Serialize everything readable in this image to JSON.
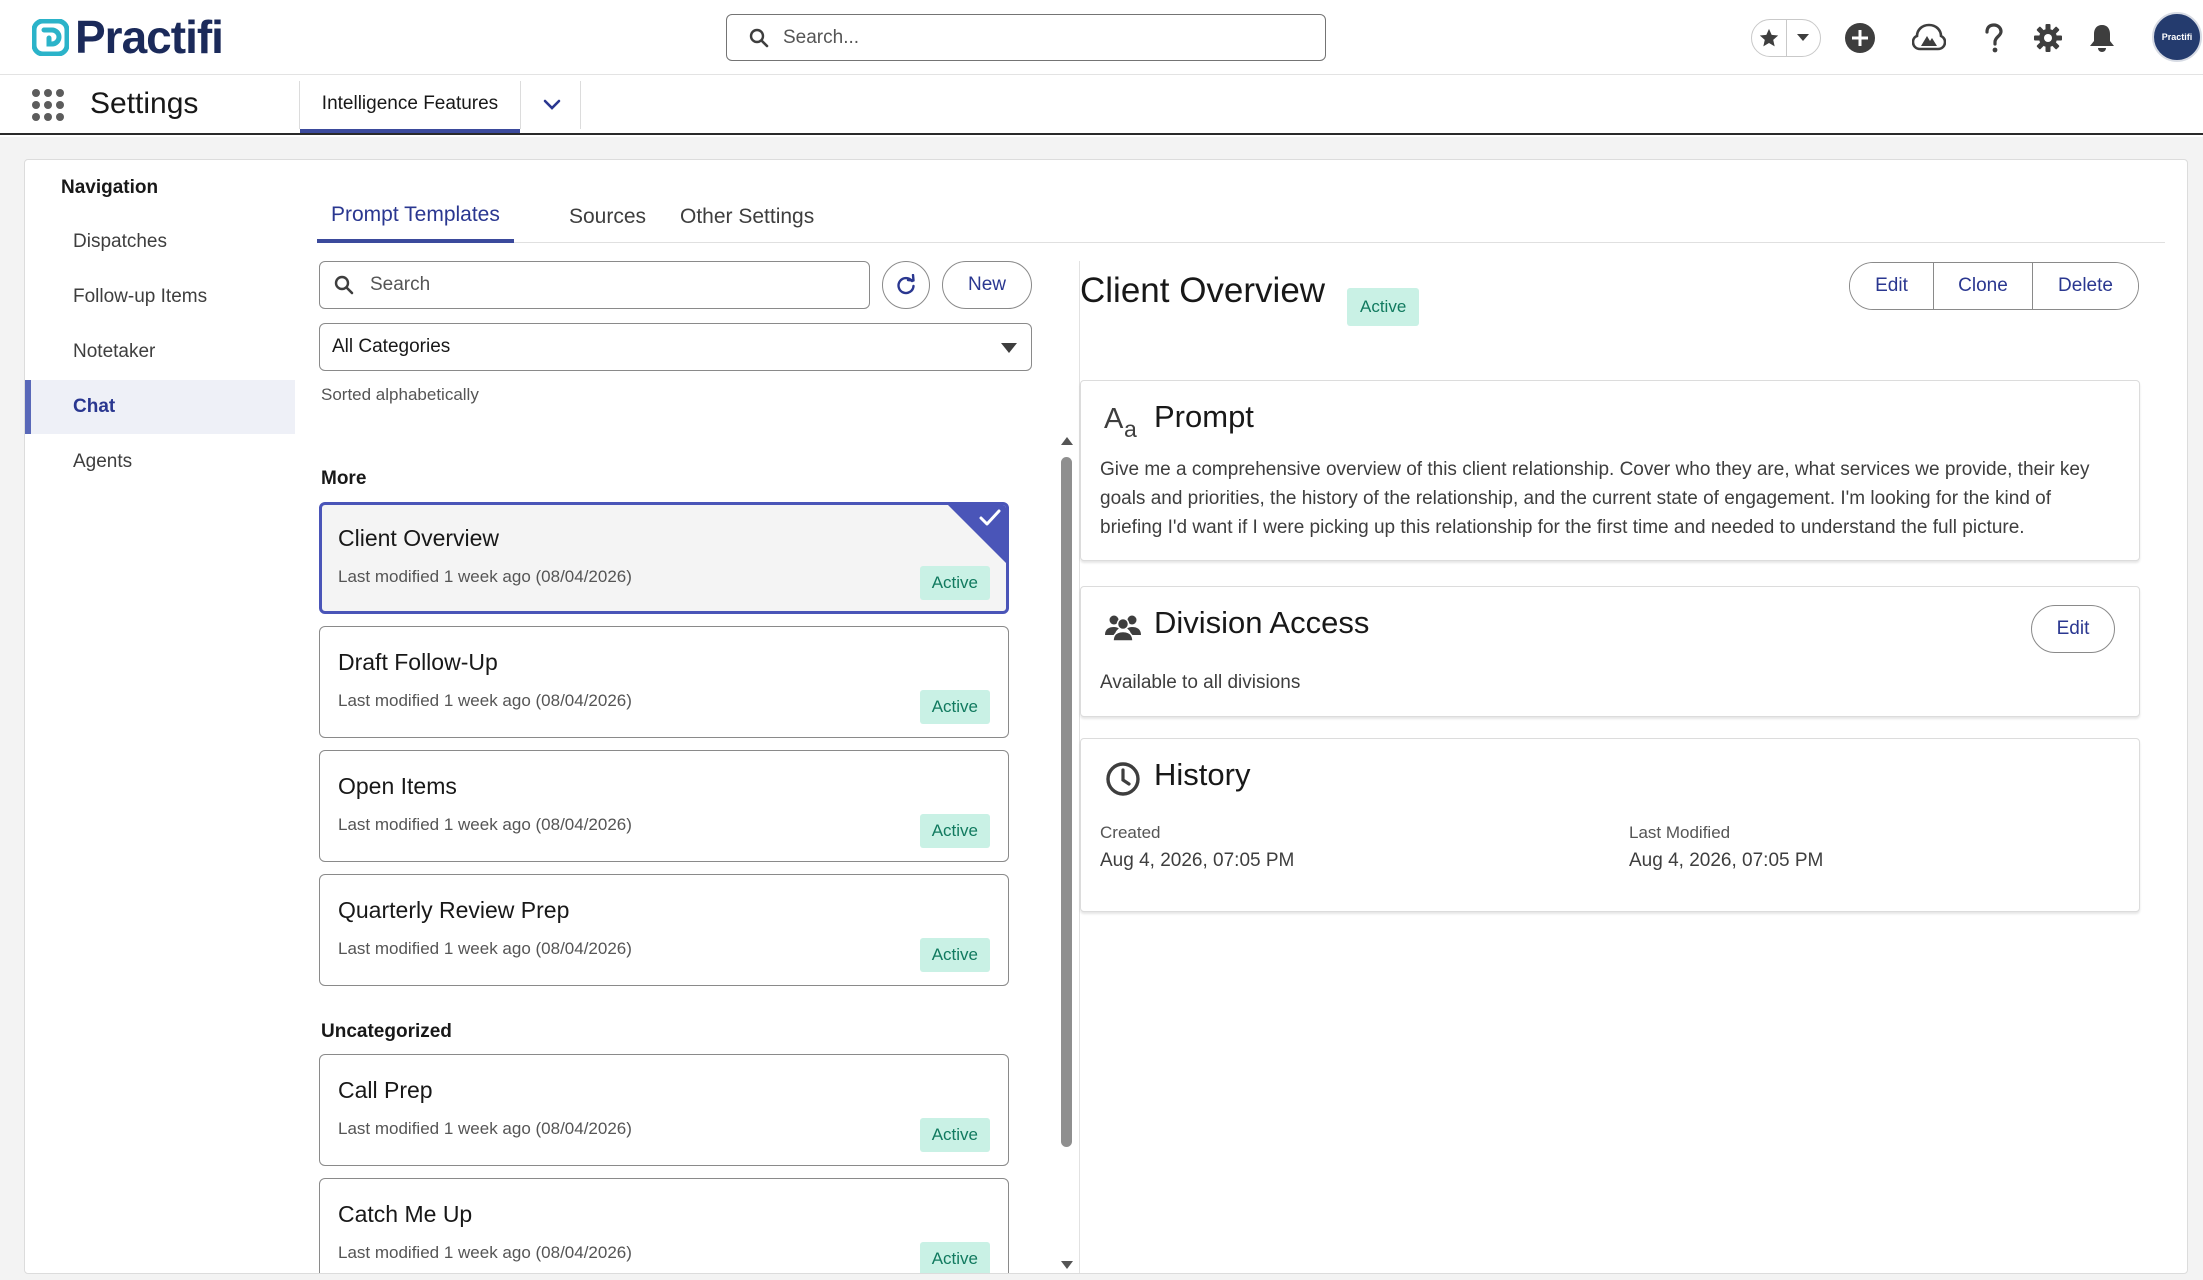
{
  "header": {
    "brand": "Practifi",
    "search_placeholder": "Search...",
    "avatar_text": "Practifi"
  },
  "appbar": {
    "app_name": "Settings",
    "tab_label": "Intelligence Features"
  },
  "left_nav": {
    "title": "Navigation",
    "items": [
      {
        "label": "Dispatches"
      },
      {
        "label": "Follow-up Items"
      },
      {
        "label": "Notetaker"
      },
      {
        "label": "Chat",
        "selected": true
      },
      {
        "label": "Agents"
      }
    ]
  },
  "subtabs": [
    {
      "label": "Prompt Templates",
      "active": true
    },
    {
      "label": "Sources"
    },
    {
      "label": "Other Settings"
    }
  ],
  "list": {
    "search_placeholder": "Search",
    "new_label": "New",
    "category_value": "All Categories",
    "sorted_note": "Sorted alphabetically",
    "groups": [
      {
        "name": "More",
        "items": [
          {
            "name": "Client Overview",
            "meta": "Last modified 1 week ago (08/04/2026)",
            "status": "Active",
            "selected": true
          },
          {
            "name": "Draft Follow-Up",
            "meta": "Last modified 1 week ago (08/04/2026)",
            "status": "Active"
          },
          {
            "name": "Open Items",
            "meta": "Last modified 1 week ago (08/04/2026)",
            "status": "Active"
          },
          {
            "name": "Quarterly Review Prep",
            "meta": "Last modified 1 week ago (08/04/2026)",
            "status": "Active"
          }
        ]
      },
      {
        "name": "Uncategorized",
        "items": [
          {
            "name": "Call Prep",
            "meta": "Last modified 1 week ago (08/04/2026)",
            "status": "Active"
          },
          {
            "name": "Catch Me Up",
            "meta": "Last modified 1 week ago (08/04/2026)",
            "status": "Active"
          }
        ]
      }
    ]
  },
  "detail": {
    "title": "Client Overview",
    "status": "Active",
    "buttons": {
      "edit": "Edit",
      "clone": "Clone",
      "delete": "Delete"
    },
    "prompt": {
      "heading": "Prompt",
      "icon_glyph": "Aa",
      "text": "Give me a comprehensive overview of this client relationship. Cover who they are, what services we provide, their key goals and priorities, the history of the relationship, and the current state of engagement. I'm looking for the kind of briefing I'd want if I were picking up this relationship for the first time and needed to understand the full picture."
    },
    "division_access": {
      "heading": "Division Access",
      "edit_label": "Edit",
      "text": "Available to all divisions"
    },
    "history": {
      "heading": "History",
      "created_label": "Created",
      "created_value": "Aug 4, 2026, 07:05 PM",
      "modified_label": "Last Modified",
      "modified_value": "Aug 4, 2026, 07:05 PM"
    }
  },
  "colors": {
    "brand_navy": "#1b2a5a",
    "brand_teal": "#2bb3c9",
    "accent": "#3b4a9c",
    "badge_bg": "#c9f1e5",
    "badge_text": "#117a5f"
  }
}
